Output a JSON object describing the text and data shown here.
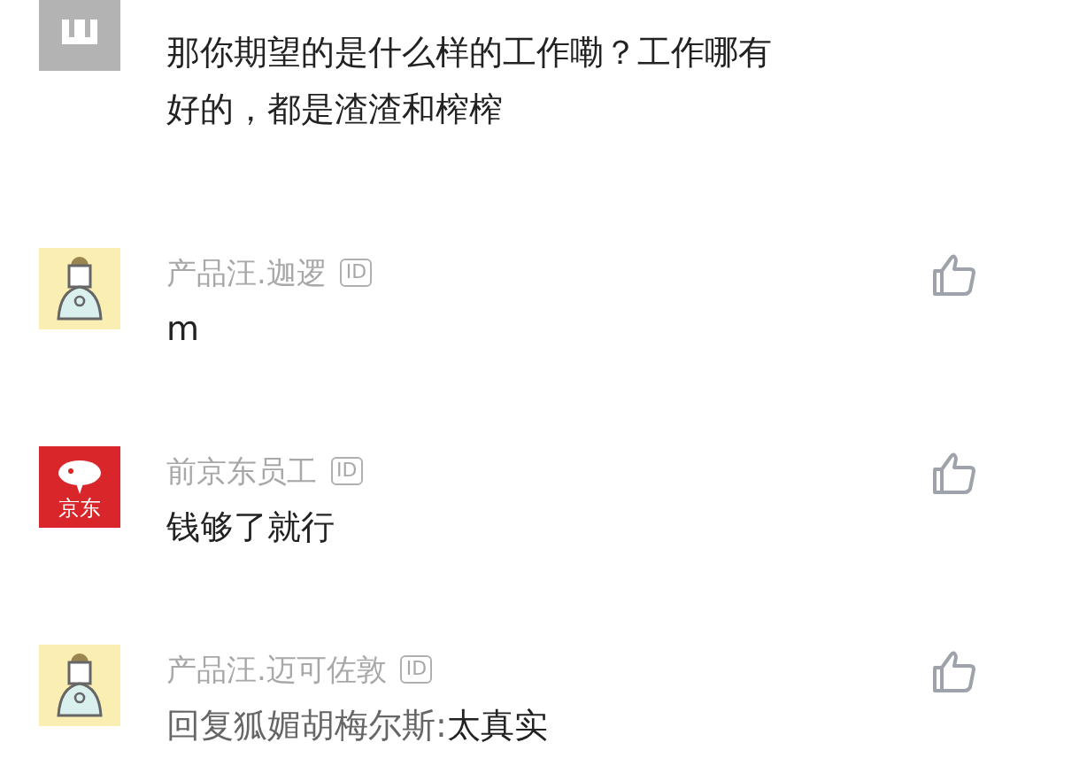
{
  "comments": [
    {
      "avatar": {
        "kind": "grey"
      },
      "body": "那你期望的是什么样的工作嘞？工作哪有好的，都是渣渣和榨榨"
    },
    {
      "avatar": {
        "kind": "figure"
      },
      "name": "产品汪.迦逻",
      "id_badge": "ID",
      "body": "m"
    },
    {
      "avatar": {
        "kind": "logo",
        "label": "京东"
      },
      "name": "前京东员工",
      "id_badge": "ID",
      "body": "钱够了就行"
    },
    {
      "avatar": {
        "kind": "figure"
      },
      "name": "产品汪.迈可佐敦",
      "id_badge": "ID",
      "reply_prefix": "回复狐媚胡梅尔斯:",
      "body": "太真实"
    }
  ]
}
